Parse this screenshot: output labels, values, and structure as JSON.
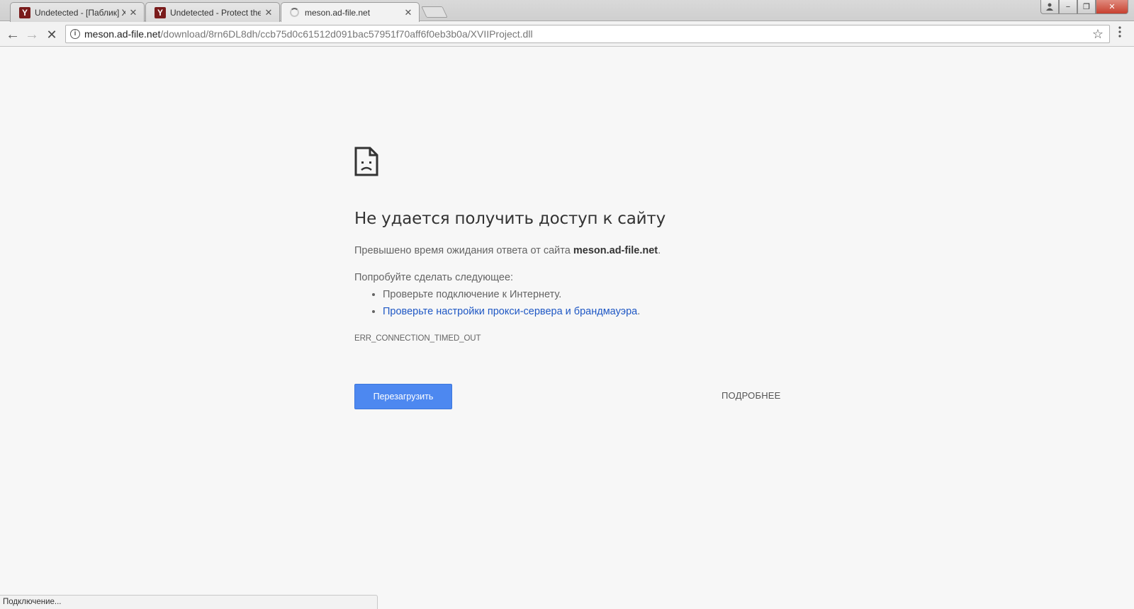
{
  "tabs": [
    {
      "title": "Undetected - [Паблик] X",
      "favicon": "Y"
    },
    {
      "title": "Undetected - Protect the",
      "favicon": "Y"
    },
    {
      "title": "meson.ad-file.net",
      "favicon": ""
    }
  ],
  "window_controls": {
    "minimize": "−",
    "maximize": "❐",
    "close": "✕"
  },
  "toolbar": {
    "back": "←",
    "forward": "→",
    "stop": "✕",
    "url_host": "meson.ad-file.net",
    "url_path": "/download/8rn6DL8dh/ccb75d0c61512d091bac57951f70aff6f0eb3b0a/XVIIProject.dll",
    "star": "☆"
  },
  "error": {
    "title": "Не удается получить доступ к сайту",
    "desc_prefix": "Превышено время ожидания ответа от сайта ",
    "desc_host": "meson.ad-file.net",
    "desc_suffix": ".",
    "suggest_heading": "Попробуйте сделать следующее:",
    "suggestion_1": "Проверьте подключение к Интернету.",
    "suggestion_2_link": "Проверьте настройки прокси-сервера и брандмауэра",
    "suggestion_2_suffix": ".",
    "code": "ERR_CONNECTION_TIMED_OUT",
    "reload_label": "Перезагрузить",
    "details_label": "ПОДРОБНЕЕ"
  },
  "status": "Подключение...",
  "colors": {
    "reload_button": "#4d88f0",
    "link": "#1e57c4",
    "page_bg": "#f7f7f7"
  }
}
